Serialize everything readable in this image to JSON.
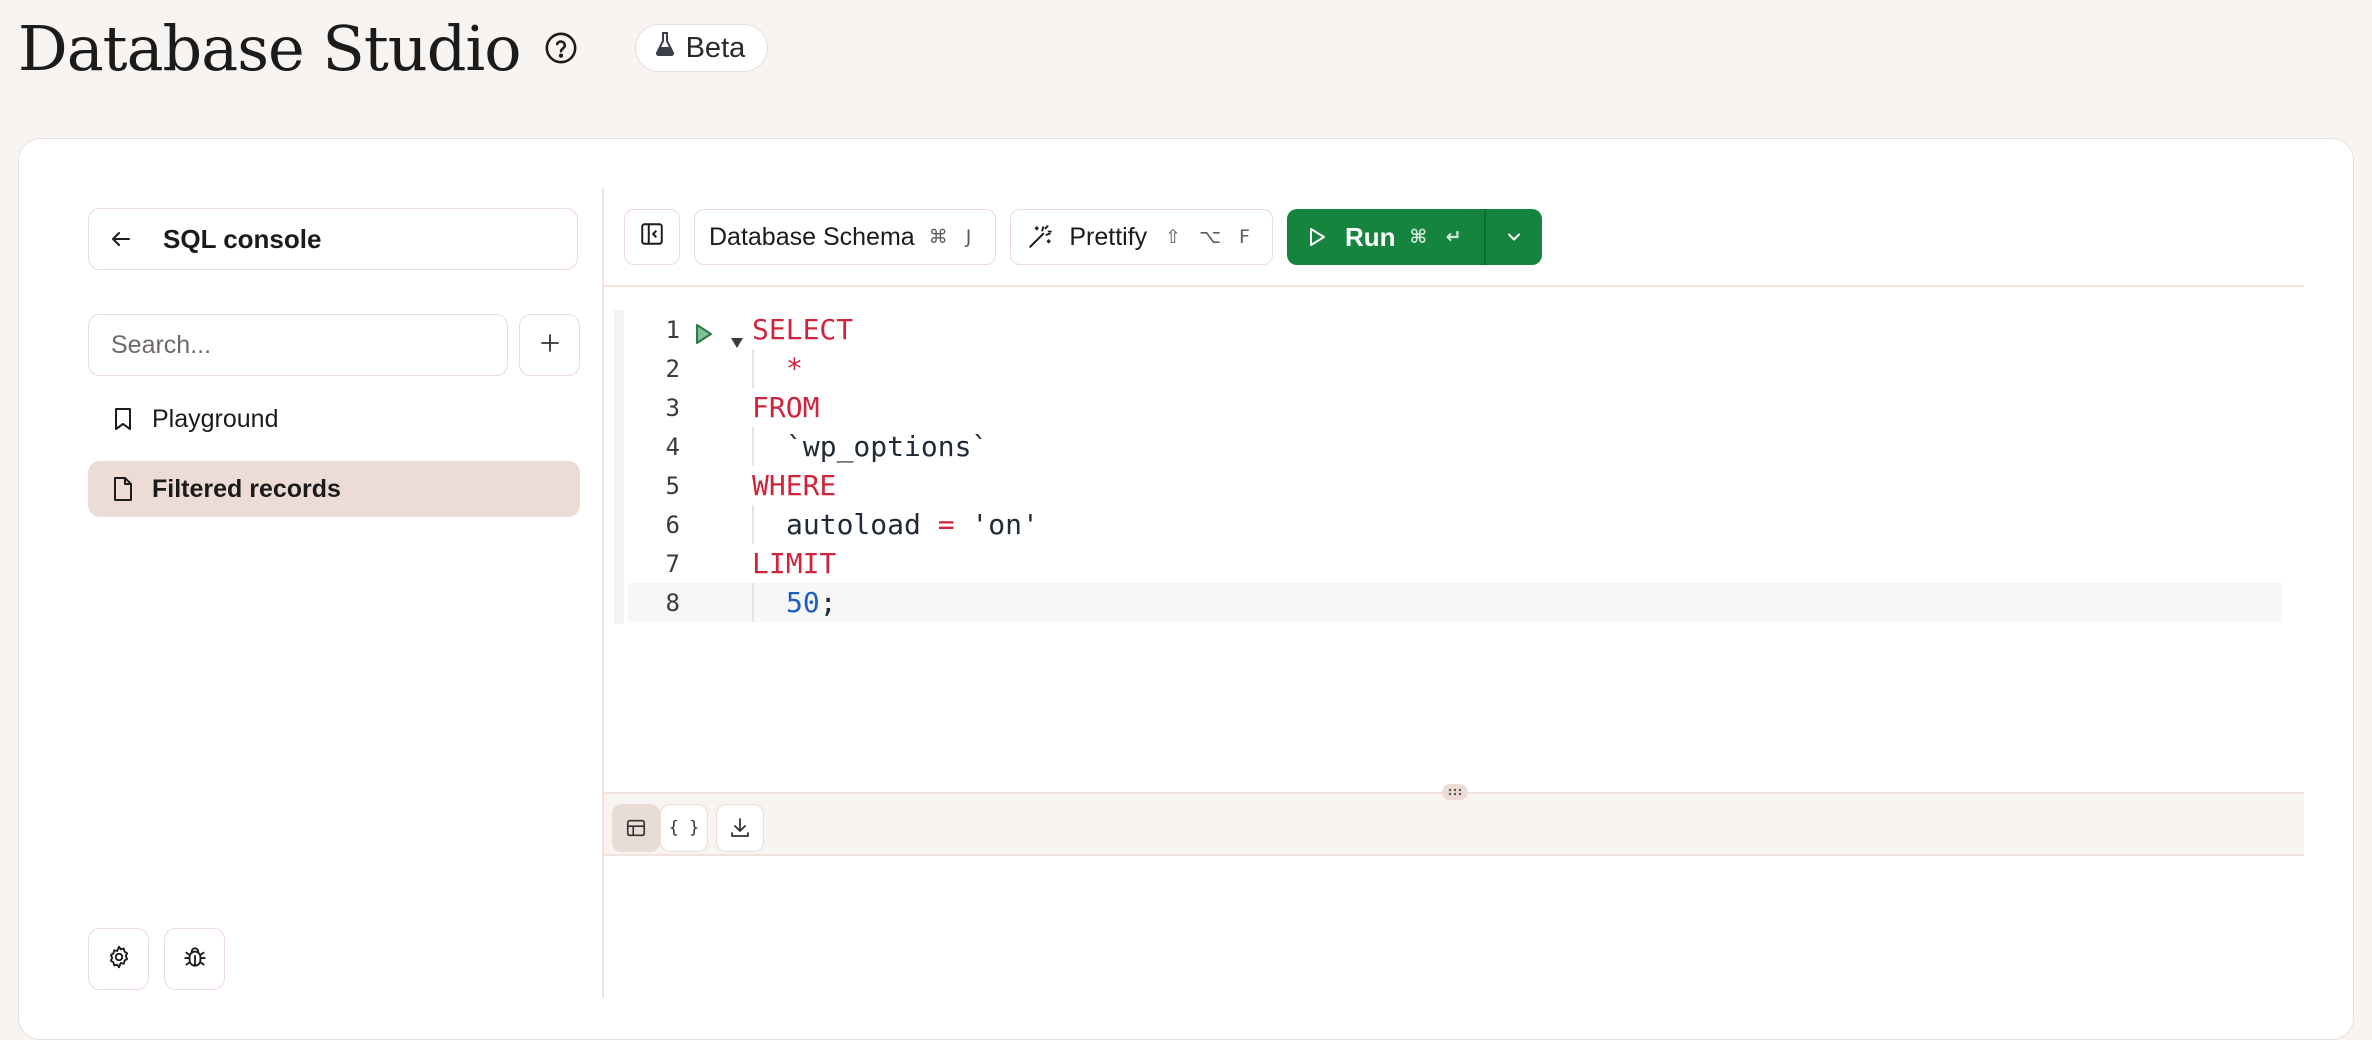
{
  "header": {
    "title": "Database Studio",
    "help_icon": "question-circle-icon",
    "badge": {
      "icon": "flask-icon",
      "label": "Beta"
    }
  },
  "sidebar": {
    "back_button_label": "SQL console",
    "search": {
      "placeholder": "Search...",
      "value": ""
    },
    "items": [
      {
        "label": "Playground",
        "icon": "bookmark-icon",
        "active": false
      },
      {
        "label": "Filtered records",
        "icon": "file-icon",
        "active": true
      }
    ],
    "footer_icons": [
      "gear-icon",
      "bug-icon"
    ]
  },
  "toolbar": {
    "schema_label": "Database Schema",
    "schema_shortcut": "⌘ J",
    "prettify_label": "Prettify",
    "prettify_shortcut": "⇧ ⌥ F",
    "run_label": "Run",
    "run_shortcut": "⌘ ↵"
  },
  "editor": {
    "line_numbers": [
      "1",
      "2",
      "3",
      "4",
      "5",
      "6",
      "7",
      "8"
    ],
    "lines": {
      "l1": "SELECT",
      "l2": "*",
      "l3": "FROM",
      "l4": "`wp_options`",
      "l5": "WHERE",
      "l6_a": "autoload ",
      "l6_op": "=",
      "l6_b": " 'on'",
      "l7": "LIMIT",
      "l8_num": "50",
      "l8_end": ";"
    },
    "current_line": 8
  },
  "results": {
    "views": [
      "table-view-icon",
      "json-view-icon",
      "download-icon"
    ],
    "json_label": "{ }"
  },
  "colors": {
    "accent_green": "#14843e",
    "keyword": "#d0243c",
    "number": "#1b5fc2",
    "active_item_bg": "#ecdcd5"
  }
}
